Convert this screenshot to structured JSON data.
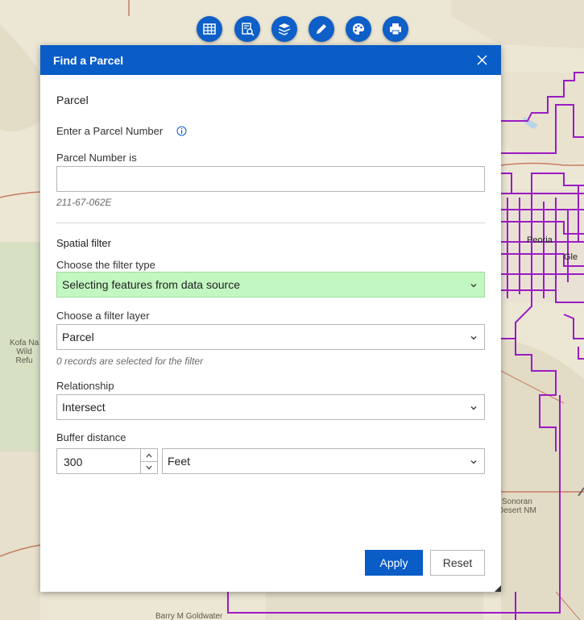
{
  "toolbar": {
    "tools": [
      {
        "icon": "table-icon"
      },
      {
        "icon": "query-icon"
      },
      {
        "icon": "layer-list-icon"
      },
      {
        "icon": "draw-icon"
      },
      {
        "icon": "basemap-gallery-icon"
      },
      {
        "icon": "print-icon"
      }
    ]
  },
  "map": {
    "labels": {
      "kofa": "Kofa Na\nWild\nRefu",
      "peoria": "Peoria",
      "glendale": "Gle",
      "sonoran": "Sonoran\nDesert NM",
      "barry": "Barry M Goldwater"
    },
    "boundary_color": "#9b1bc4",
    "road_color": "#c77a62"
  },
  "panel": {
    "title": "Find a Parcel",
    "section_title": "Parcel",
    "enter_label": "Enter a Parcel Number",
    "parcel_number_label": "Parcel Number is",
    "parcel_number_value": "",
    "parcel_number_hint": "211-67-062E",
    "spatial_title": "Spatial filter",
    "filter_type_label": "Choose the filter type",
    "filter_type_value": "Selecting features from data source",
    "filter_layer_label": "Choose a filter layer",
    "filter_layer_value": "Parcel",
    "records_hint": "0 records are selected for the filter",
    "relationship_label": "Relationship",
    "relationship_value": "Intersect",
    "buffer_label": "Buffer distance",
    "buffer_value": "300",
    "buffer_unit": "Feet",
    "apply_label": "Apply",
    "reset_label": "Reset"
  },
  "colors": {
    "header": "#0a5cc7",
    "filter_type_highlight": "#c3f7c1",
    "tool_button": "#0e5fc7"
  }
}
